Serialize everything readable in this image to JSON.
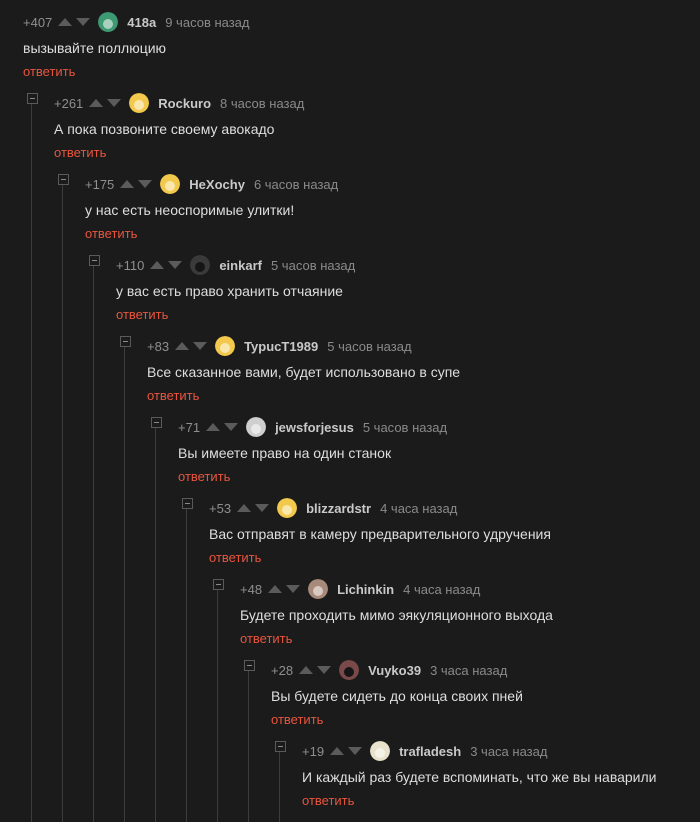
{
  "comments": [
    {
      "rating": "+407",
      "user": "418a",
      "time": "9 часов назад",
      "text": "вызывайте поллюцию",
      "reply": "ответить",
      "avatar": "#3e9a73"
    },
    {
      "rating": "+261",
      "user": "Rockuro",
      "time": "8 часов назад",
      "text": "А пока позвоните своему авокадо",
      "reply": "ответить",
      "avatar": "#f2c94c"
    },
    {
      "rating": "+175",
      "user": "HeXochy",
      "time": "6 часов назад",
      "text": "у нас есть неоспоримые улитки!",
      "reply": "ответить",
      "avatar": "#f2c94c"
    },
    {
      "rating": "+110",
      "user": "einkarf",
      "time": "5 часов назад",
      "text": "у вас есть право хранить отчаяние",
      "reply": "ответить",
      "avatar": "#3a3a3a"
    },
    {
      "rating": "+83",
      "user": "TypucT1989",
      "time": "5 часов назад",
      "text": "Все сказанное вами, будет использовано в супе",
      "reply": "ответить",
      "avatar": "#f2c94c"
    },
    {
      "rating": "+71",
      "user": "jewsforjesus",
      "time": "5 часов назад",
      "text": "Вы имеете право на один станок",
      "reply": "ответить",
      "avatar": "#cfcfcf"
    },
    {
      "rating": "+53",
      "user": "blizzardstr",
      "time": "4 часа назад",
      "text": "Вас отправят в камеру предварительного удручения",
      "reply": "ответить",
      "avatar": "#f2c94c"
    },
    {
      "rating": "+48",
      "user": "Lichinkin",
      "time": "4 часа назад",
      "text": "Будете проходить мимо эякуляционного выхода",
      "reply": "ответить",
      "avatar": "#a88a7a"
    },
    {
      "rating": "+28",
      "user": "Vuyko39",
      "time": "3 часа назад",
      "text": "Вы будете сидеть до конца своих пней",
      "reply": "ответить",
      "avatar": "#7a4a4a"
    },
    {
      "rating": "+19",
      "user": "trafladesh",
      "time": "3 часа назад",
      "text": "И каждый раз будете вспоминать, что же вы наварили",
      "reply": "ответить",
      "avatar": "#e8e2cc"
    }
  ]
}
